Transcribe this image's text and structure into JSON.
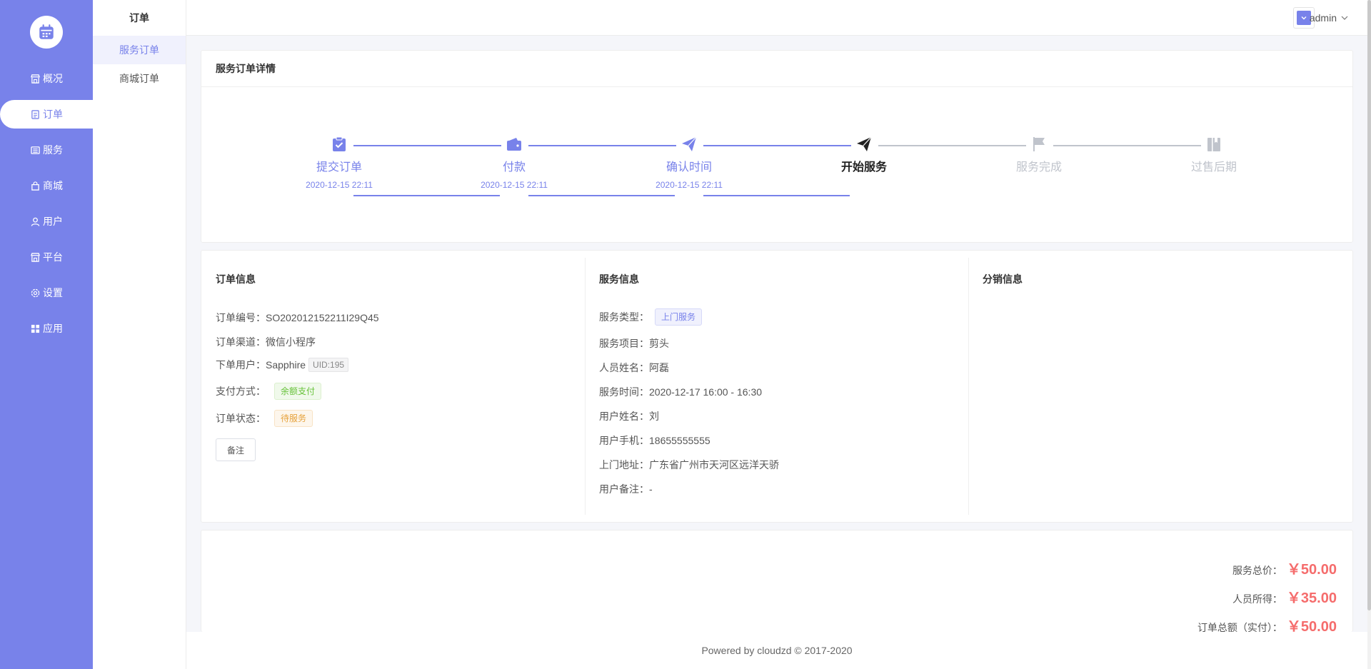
{
  "colors": {
    "primary": "#7882ea",
    "inactive": "#c0c4cc",
    "current": "#333333",
    "price": "#f56c6c"
  },
  "nav": {
    "items": [
      {
        "label": "概况",
        "icon": "shop-icon"
      },
      {
        "label": "订单",
        "icon": "document-icon"
      },
      {
        "label": "服务",
        "icon": "list-icon"
      },
      {
        "label": "商城",
        "icon": "bag-icon"
      },
      {
        "label": "用户",
        "icon": "user-icon"
      },
      {
        "label": "平台",
        "icon": "store-icon"
      },
      {
        "label": "设置",
        "icon": "gear-icon"
      },
      {
        "label": "应用",
        "icon": "grid-icon"
      }
    ],
    "active_index": 1
  },
  "subnav": {
    "title": "订单",
    "items": [
      {
        "label": "服务订单"
      },
      {
        "label": "商城订单"
      }
    ],
    "active_index": 0
  },
  "topbar": {
    "user": "admin"
  },
  "detail": {
    "title": "服务订单详情",
    "steps": [
      {
        "label": "提交订单",
        "time": "2020-12-15 22:11",
        "icon": "clipboard-check-icon",
        "state": "done"
      },
      {
        "label": "付款",
        "time": "2020-12-15 22:11",
        "icon": "wallet-icon",
        "state": "done"
      },
      {
        "label": "确认时间",
        "time": "2020-12-15 22:11",
        "icon": "paper-plane-icon",
        "state": "done"
      },
      {
        "label": "开始服务",
        "time": "",
        "icon": "send-icon",
        "state": "current"
      },
      {
        "label": "服务完成",
        "time": "",
        "icon": "flag-icon",
        "state": "pending"
      },
      {
        "label": "过售后期",
        "time": "",
        "icon": "book-icon",
        "state": "pending"
      }
    ]
  },
  "order_info": {
    "title": "订单信息",
    "number_label": "订单编号：",
    "number": "SO202012152211I29Q45",
    "channel_label": "订单渠道：",
    "channel": "微信小程序",
    "user_label": "下单用户：",
    "user": "Sapphire",
    "uid": "UID:195",
    "pay_label": "支付方式：",
    "pay": "余额支付",
    "status_label": "订单状态：",
    "status": "待服务",
    "remark_button": "备注"
  },
  "service_info": {
    "title": "服务信息",
    "type_label": "服务类型：",
    "type": "上门服务",
    "rows": [
      {
        "label": "服务项目：",
        "value": "剪头"
      },
      {
        "label": "人员姓名：",
        "value": "阿磊"
      },
      {
        "label": "服务时间：",
        "value": "2020-12-17 16:00 - 16:30"
      },
      {
        "label": "用户姓名：",
        "value": "刘"
      },
      {
        "label": "用户手机：",
        "value": "18655555555"
      },
      {
        "label": "上门地址：",
        "value": "广东省广州市天河区远洋天骄"
      },
      {
        "label": "用户备注：",
        "value": "-"
      }
    ]
  },
  "distribution_info": {
    "title": "分销信息"
  },
  "prices": [
    {
      "label": "服务总价：",
      "value": "￥50.00"
    },
    {
      "label": "人员所得：",
      "value": "￥35.00"
    },
    {
      "label": "订单总额（实付）：",
      "value": "￥50.00"
    }
  ],
  "footer": {
    "text": "Powered by cloudzd © 2017-2020"
  }
}
